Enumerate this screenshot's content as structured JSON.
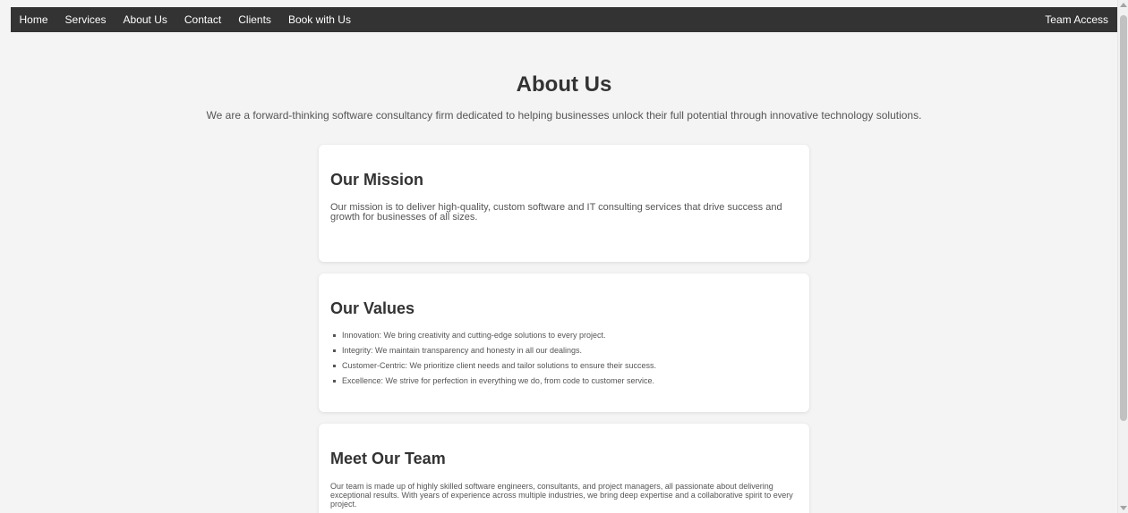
{
  "nav": {
    "left_links": [
      "Home",
      "Services",
      "About Us",
      "Contact",
      "Clients",
      "Book with Us"
    ],
    "right_link": "Team Access",
    "background": "#333333",
    "text_color": "#ffffff"
  },
  "hero": {
    "title": "About Us",
    "subtitle": "We are a forward-thinking software consultancy firm dedicated to helping businesses unlock their full potential through innovative technology solutions."
  },
  "mission": {
    "title": "Our Mission",
    "body": "Our mission is to deliver high-quality, custom software and IT consulting services that drive success and growth for businesses of all sizes."
  },
  "values": {
    "title": "Our Values",
    "items": [
      "Innovation: We bring creativity and cutting-edge solutions to every project.",
      "Integrity: We maintain transparency and honesty in all our dealings.",
      "Customer-Centric: We prioritize client needs and tailor solutions to ensure their success.",
      "Excellence: We strive for perfection in everything we do, from code to customer service."
    ]
  },
  "team": {
    "title": "Meet Our Team",
    "body": "Our team is made up of highly skilled software engineers, consultants, and project managers, all passionate about delivering exceptional results. With years of experience across multiple industries, we bring deep expertise and a collaborative spirit to every project."
  },
  "icons": {
    "scroll_up": "triangle-up-icon",
    "scroll_down": "triangle-down-icon"
  }
}
